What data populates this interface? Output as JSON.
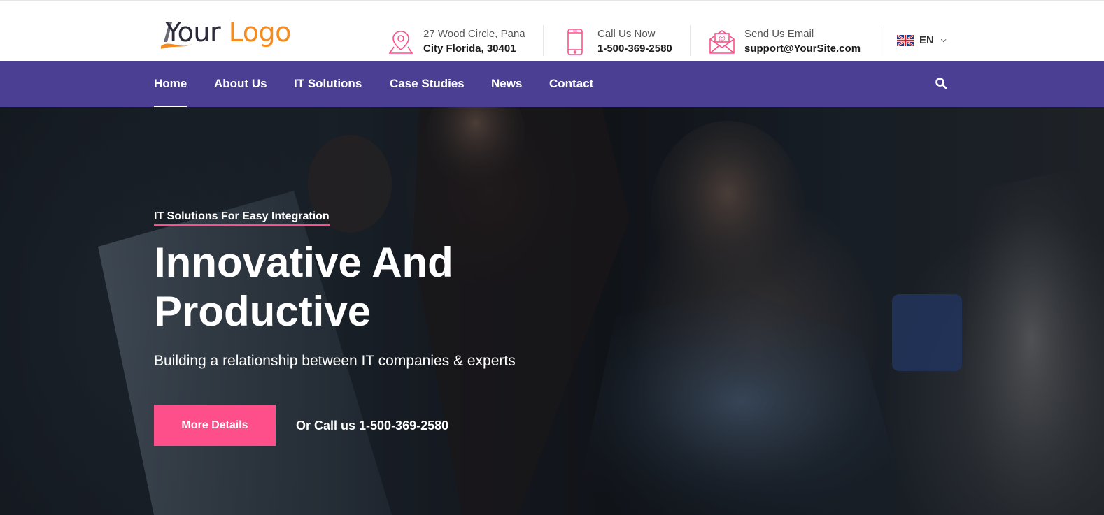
{
  "logo": {
    "word1": "Your",
    "word2": "Logo"
  },
  "contact": {
    "address": {
      "label": "27 Wood Circle, Pana",
      "value": "City Florida, 30401"
    },
    "phone": {
      "label": "Call Us Now",
      "value": "1-500-369-2580"
    },
    "email": {
      "label": "Send Us Email",
      "value": "support@YourSite.com"
    }
  },
  "language": {
    "selected": "EN"
  },
  "nav": {
    "items": [
      {
        "label": "Home"
      },
      {
        "label": "About Us"
      },
      {
        "label": "IT Solutions"
      },
      {
        "label": "Case Studies"
      },
      {
        "label": "News"
      },
      {
        "label": "Contact"
      }
    ]
  },
  "hero": {
    "subtitle": "IT Solutions For Easy Integration",
    "title_line1": "Innovative And",
    "title_line2": "Productive",
    "description": "Building a relationship between IT companies & experts",
    "button_label": "More Details",
    "call_text": "Or Call us 1-500-369-2580"
  },
  "colors": {
    "nav_bg": "#4b3f93",
    "accent_pink": "#ff4f8b",
    "logo_orange": "#f58a1f"
  },
  "icons": [
    "map-pin-icon",
    "mobile-phone-icon",
    "envelope-icon",
    "uk-flag-icon",
    "chevron-down-icon",
    "search-icon"
  ]
}
